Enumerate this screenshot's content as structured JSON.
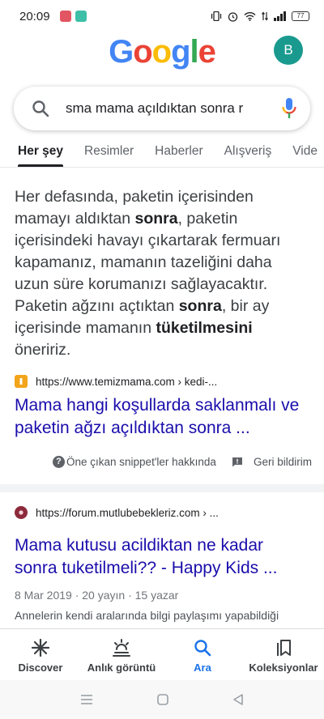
{
  "status_bar": {
    "time": "20:09",
    "battery": "77"
  },
  "header": {
    "logo_letters": [
      "G",
      "o",
      "o",
      "g",
      "l",
      "e"
    ],
    "logo_colors": [
      "#4285f4",
      "#ea4335",
      "#fbbc05",
      "#4285f4",
      "#34a853",
      "#ea4335"
    ],
    "avatar_letter": "B"
  },
  "search": {
    "query": "sma mama açıldıktan sonra r"
  },
  "tabs": [
    {
      "label": "Her şey",
      "active": true
    },
    {
      "label": "Resimler"
    },
    {
      "label": "Haberler"
    },
    {
      "label": "Alışveriş"
    },
    {
      "label": "Vide"
    }
  ],
  "featured_snippet": {
    "parts": [
      "Her defasında, paketin içerisinden mamayı aldıktan ",
      "sonra",
      ", paketin içerisindeki havayı çıkartarak fermuarı kapamanız, mamanın tazeliğini daha uzun süre korumanızı sağlayacaktır. Paketin ağzını açtıktan ",
      "sonra",
      ", bir ay içerisinde mamanın ",
      "tüketilmesini",
      " öneririz."
    ],
    "source_url": "https://www.temizmama.com › kedi-...",
    "title": "Mama hangi koşullarda saklanmalı ve paketin ağzı açıldıktan sonra ...",
    "about_label": "Öne çıkan snippet'ler hakkında",
    "feedback_label": "Geri bildirim"
  },
  "result2": {
    "source_url": "https://forum.mutlubebekleriz.com › ...",
    "title": "Mama kutusu acildiktan ne kadar sonra tuketilmeli?? - Happy Kids ...",
    "meta": "8 Mar 2019 · 20 yayın · 15 yazar",
    "desc": "Annelerin kendi aralarında bilgi paylaşımı yapabildiği"
  },
  "bottom_nav": [
    {
      "label": "Discover",
      "icon": "asterisk-icon"
    },
    {
      "label": "Anlık görüntü",
      "icon": "snapshot-icon"
    },
    {
      "label": "Ara",
      "icon": "search-icon",
      "active": true
    },
    {
      "label": "Koleksiyonlar",
      "icon": "collections-icon"
    }
  ],
  "colors": {
    "link": "#1a0dab",
    "accent": "#1a73e8",
    "avatar_bg": "#1a9a8f"
  }
}
